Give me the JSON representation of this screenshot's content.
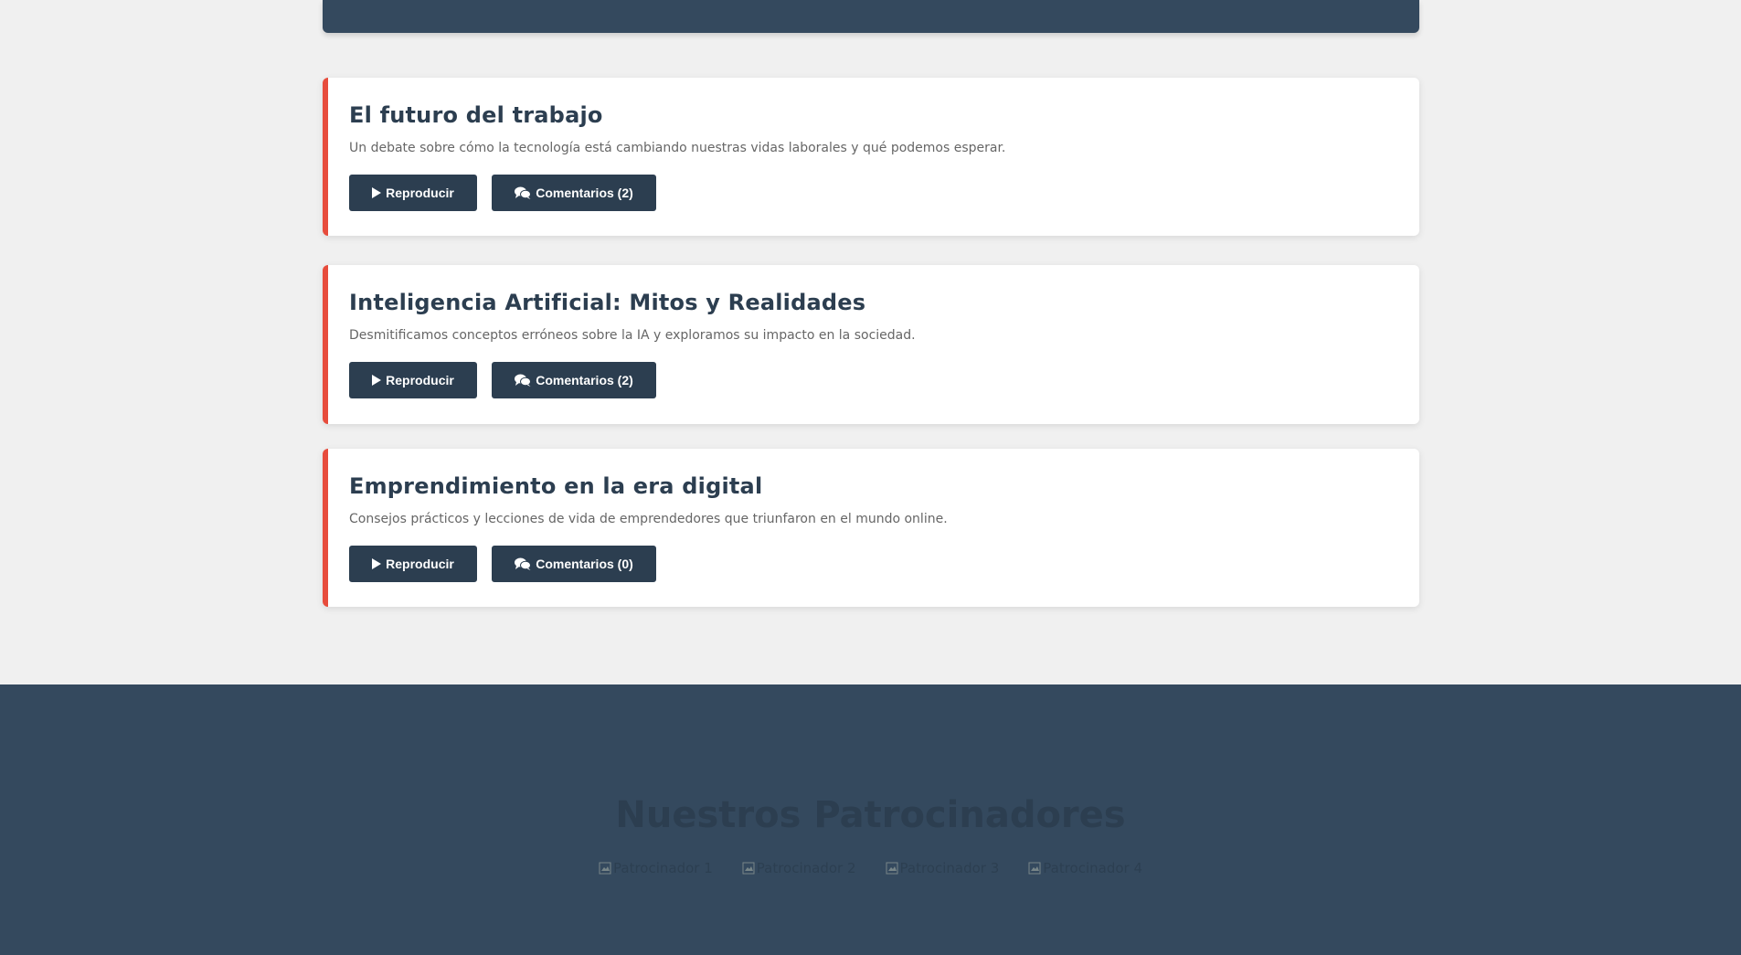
{
  "episodes": [
    {
      "title": "El futuro del trabajo",
      "description": "Un debate sobre cómo la tecnología está cambiando nuestras vidas laborales y qué podemos esperar.",
      "play_label": "Reproducir",
      "comments_label": "Comentarios (2)"
    },
    {
      "title": "Inteligencia Artificial: Mitos y Realidades",
      "description": "Desmitificamos conceptos erróneos sobre la IA y exploramos su impacto en la sociedad.",
      "play_label": "Reproducir",
      "comments_label": "Comentarios (2)"
    },
    {
      "title": "Emprendimiento en la era digital",
      "description": "Consejos prácticos y lecciones de vida de emprendedores que triunfaron en el mundo online.",
      "play_label": "Reproducir",
      "comments_label": "Comentarios (0)"
    }
  ],
  "sponsors": {
    "title": "Nuestros Patrocinadores",
    "logos": [
      "Patrocinador 1",
      "Patrocinador 2",
      "Patrocinador 3",
      "Patrocinador 4"
    ]
  },
  "icons": {
    "play": "play-icon",
    "comments": "comments-icon",
    "broken_image": "broken-image-icon"
  },
  "colors": {
    "accent": "#e74c3c",
    "primary_dark": "#2c3e50",
    "banner": "#34495e",
    "background": "#f0f0f0"
  }
}
